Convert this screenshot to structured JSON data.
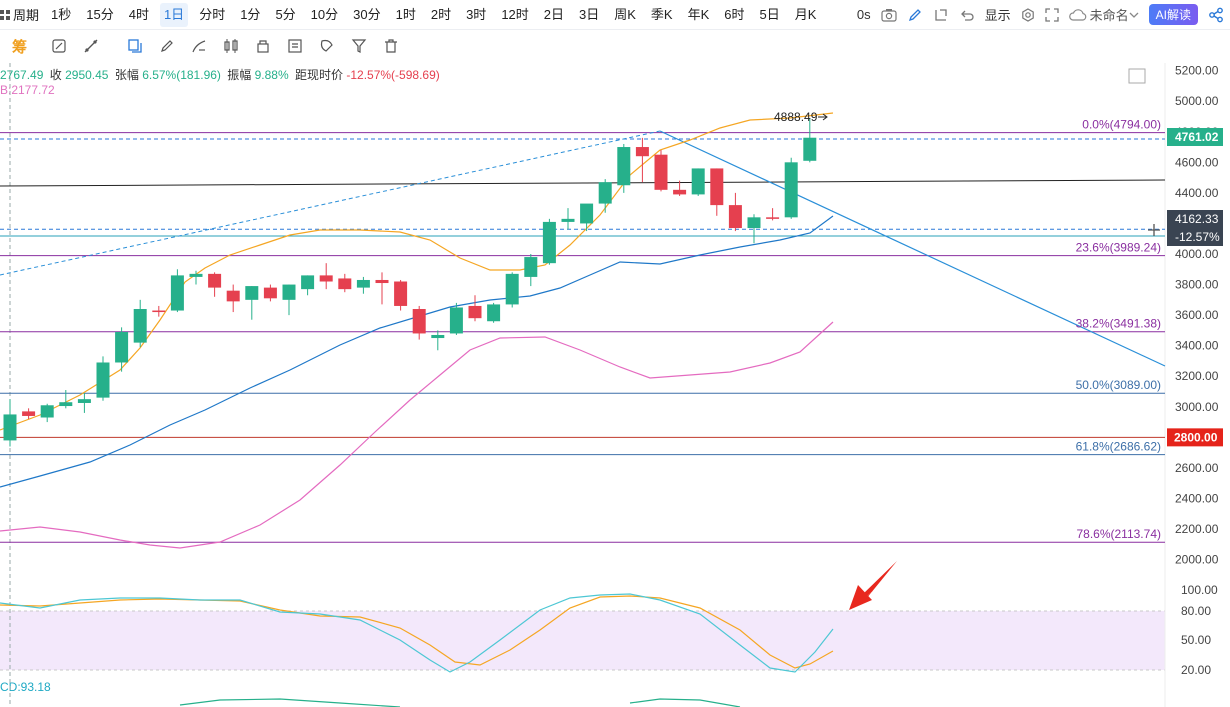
{
  "toolbar": {
    "period_label": "周期",
    "periods": [
      "1秒",
      "15分",
      "4时",
      "1日",
      "分时",
      "1分",
      "5分",
      "10分",
      "30分",
      "1时",
      "2时",
      "3时",
      "12时",
      "2日",
      "3日",
      "周K",
      "季K",
      "年K",
      "6时",
      "5日",
      "月K"
    ],
    "active_period": "1日",
    "latency": "0s",
    "display_label": "显示",
    "layout_name": "未命名",
    "ai_label": "AI解读"
  },
  "drawbar": {
    "first_icon_label": "筹",
    "icons": [
      "chip-icon",
      "ruler-icon",
      "pencil-icon",
      "measure-icon",
      "copy-icon",
      "edit-icon",
      "brush-icon",
      "candle-icon",
      "lock-icon",
      "note-icon",
      "magnet-icon",
      "filter-icon",
      "trash-icon"
    ]
  },
  "stats": {
    "open": "2767.49",
    "close_label": "收",
    "close": "2950.45",
    "change_label": "张幅",
    "change": "6.57%(181.96)",
    "amplitude_label": "振幅",
    "amplitude": "9.88%",
    "distance_label": "距现时价",
    "distance": "-12.57%(-598.69)"
  },
  "ma_readout": "B:2177.72",
  "macd_readout": "CD:93.18",
  "price_axis": {
    "ticks": [
      "5200.00",
      "5000.00",
      "4800.00",
      "4600.00",
      "4400.00",
      "4200.00",
      "4000.00",
      "3800.00",
      "3600.00",
      "3400.00",
      "3200.00",
      "3000.00",
      "2800.00",
      "2600.00",
      "2400.00",
      "2200.00",
      "2000.00"
    ],
    "current_price": "4761.02",
    "crosshair_price": "4162.33",
    "crosshair_pct": "-12.57%",
    "marked_price": "2800.00"
  },
  "oscillator_axis": {
    "ticks": [
      "100.00",
      "80.00",
      "50.00",
      "20.00"
    ]
  },
  "fib_labels": [
    "0.0%(4794.00)",
    "23.6%(3989.24)",
    "38.2%(3491.38)",
    "50.0%(3089.00)",
    "61.8%(2686.62)",
    "78.6%(2113.74)"
  ],
  "high_label": "4888.49",
  "colors": {
    "up": "#26b08b",
    "down": "#e5404f",
    "accent": "#2a79d8",
    "fib": "#8a2fa0",
    "ma5": "#f5a623",
    "ma20": "#1f78c8",
    "ma60": "#e46bc0",
    "osc_fill": "#f3e8fb",
    "arrow": "#e8281e"
  },
  "chart_data": {
    "type": "candlestick",
    "price_range": [
      1850,
      5250
    ],
    "dates_visible": false,
    "candles": [
      {
        "o": 2780,
        "h": 3050,
        "l": 2740,
        "c": 2950
      },
      {
        "o": 2970,
        "h": 2990,
        "l": 2920,
        "c": 2940
      },
      {
        "o": 2930,
        "h": 3020,
        "l": 2900,
        "c": 3010
      },
      {
        "o": 3005,
        "h": 3110,
        "l": 2990,
        "c": 3030
      },
      {
        "o": 3025,
        "h": 3090,
        "l": 2960,
        "c": 3050
      },
      {
        "o": 3060,
        "h": 3330,
        "l": 3040,
        "c": 3290
      },
      {
        "o": 3290,
        "h": 3520,
        "l": 3230,
        "c": 3490
      },
      {
        "o": 3420,
        "h": 3700,
        "l": 3390,
        "c": 3640
      },
      {
        "o": 3630,
        "h": 3660,
        "l": 3590,
        "c": 3620
      },
      {
        "o": 3630,
        "h": 3900,
        "l": 3620,
        "c": 3860
      },
      {
        "o": 3850,
        "h": 3890,
        "l": 3800,
        "c": 3870
      },
      {
        "o": 3870,
        "h": 3880,
        "l": 3720,
        "c": 3780
      },
      {
        "o": 3760,
        "h": 3800,
        "l": 3620,
        "c": 3690
      },
      {
        "o": 3700,
        "h": 3790,
        "l": 3570,
        "c": 3790
      },
      {
        "o": 3780,
        "h": 3800,
        "l": 3690,
        "c": 3710
      },
      {
        "o": 3700,
        "h": 3800,
        "l": 3600,
        "c": 3800
      },
      {
        "o": 3770,
        "h": 3860,
        "l": 3730,
        "c": 3860
      },
      {
        "o": 3860,
        "h": 3940,
        "l": 3770,
        "c": 3820
      },
      {
        "o": 3840,
        "h": 3870,
        "l": 3750,
        "c": 3770
      },
      {
        "o": 3780,
        "h": 3850,
        "l": 3740,
        "c": 3830
      },
      {
        "o": 3830,
        "h": 3880,
        "l": 3670,
        "c": 3810
      },
      {
        "o": 3820,
        "h": 3830,
        "l": 3630,
        "c": 3660
      },
      {
        "o": 3640,
        "h": 3660,
        "l": 3440,
        "c": 3480
      },
      {
        "o": 3450,
        "h": 3500,
        "l": 3370,
        "c": 3470
      },
      {
        "o": 3480,
        "h": 3680,
        "l": 3470,
        "c": 3650
      },
      {
        "o": 3660,
        "h": 3730,
        "l": 3560,
        "c": 3580
      },
      {
        "o": 3560,
        "h": 3680,
        "l": 3550,
        "c": 3670
      },
      {
        "o": 3670,
        "h": 3880,
        "l": 3650,
        "c": 3870
      },
      {
        "o": 3850,
        "h": 4000,
        "l": 3790,
        "c": 3980
      },
      {
        "o": 3940,
        "h": 4230,
        "l": 3930,
        "c": 4210
      },
      {
        "o": 4210,
        "h": 4300,
        "l": 4160,
        "c": 4230
      },
      {
        "o": 4200,
        "h": 4320,
        "l": 4150,
        "c": 4330
      },
      {
        "o": 4330,
        "h": 4490,
        "l": 4270,
        "c": 4470
      },
      {
        "o": 4450,
        "h": 4720,
        "l": 4400,
        "c": 4700
      },
      {
        "o": 4700,
        "h": 4760,
        "l": 4470,
        "c": 4640
      },
      {
        "o": 4650,
        "h": 4680,
        "l": 4410,
        "c": 4420
      },
      {
        "o": 4420,
        "h": 4480,
        "l": 4380,
        "c": 4390
      },
      {
        "o": 4390,
        "h": 4560,
        "l": 4380,
        "c": 4560
      },
      {
        "o": 4560,
        "h": 4560,
        "l": 4250,
        "c": 4320
      },
      {
        "o": 4320,
        "h": 4400,
        "l": 4150,
        "c": 4170
      },
      {
        "o": 4170,
        "h": 4260,
        "l": 4070,
        "c": 4240
      },
      {
        "o": 4240,
        "h": 4300,
        "l": 4220,
        "c": 4230
      },
      {
        "o": 4240,
        "h": 4630,
        "l": 4230,
        "c": 4600
      },
      {
        "o": 4610,
        "h": 4888.49,
        "l": 4600,
        "c": 4761.02
      }
    ],
    "fibonacci": [
      {
        "ratio": "0.0%",
        "price": 4794.0
      },
      {
        "ratio": "23.6%",
        "price": 3989.24
      },
      {
        "ratio": "38.2%",
        "price": 3491.38
      },
      {
        "ratio": "50.0%",
        "price": 3089.0
      },
      {
        "ratio": "61.8%",
        "price": 2686.62
      },
      {
        "ratio": "78.6%",
        "price": 2113.74
      }
    ],
    "horizontal_lines": [
      4162.33,
      2800.0
    ],
    "oscillator": {
      "range": [
        0,
        110
      ],
      "levels": [
        80,
        20
      ]
    }
  }
}
